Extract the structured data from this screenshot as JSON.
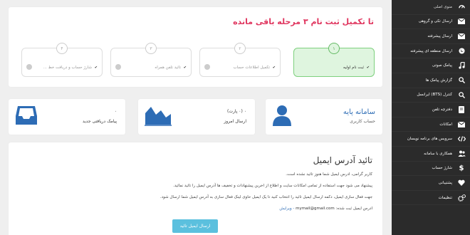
{
  "sidebar": {
    "items": [
      {
        "label": "منوی اصلی",
        "icon": "dashboard-icon"
      },
      {
        "label": "ارسال تکی و گروهی",
        "icon": "envelope-icon"
      },
      {
        "label": "ارسال پیشرفته",
        "icon": "envelope-icon"
      },
      {
        "label": "ارسال منطقه ای پیشرفته",
        "icon": "globe-icon"
      },
      {
        "label": "پیامک صوتی",
        "icon": "music-icon"
      },
      {
        "label": "گزارش پیامک ها",
        "icon": "search-icon"
      },
      {
        "label": "کنترل (BTS) ایرانسل",
        "icon": "search-icon"
      },
      {
        "label": "دفترچه تلفن",
        "icon": "phonebook-icon"
      },
      {
        "label": "امکانات",
        "icon": "envelope-icon"
      },
      {
        "label": "سرویس های برنامه نویسان",
        "icon": "code-icon"
      },
      {
        "label": "همکاری با سامانه",
        "icon": "users-icon"
      },
      {
        "label": "شارژ حساب",
        "icon": "dollar-icon"
      },
      {
        "label": "پشتیبانی",
        "icon": "heart-icon"
      },
      {
        "label": "تنظیمات",
        "icon": "cogs-icon"
      }
    ]
  },
  "steps": {
    "title": "تا تکمیل ثبت نام ۳ مرحله باقی مانده",
    "items": [
      {
        "num": "۱",
        "label": "ثبت نام اولیه"
      },
      {
        "num": "۲",
        "label": "تکمیل اطلاعات حساب"
      },
      {
        "num": "۳",
        "label": "تائید تلفن همراه"
      },
      {
        "num": "۴",
        "label": "شارژ حساب و دریافت خط ..."
      }
    ]
  },
  "stats": {
    "plan": {
      "title": "سامانه پایه",
      "sub": "حساب کاربری"
    },
    "sent": {
      "value": "۰ (۰ پارت)",
      "label": "ارسال امروز"
    },
    "inbox": {
      "value": "۰",
      "label": "پیامک دریافتی جدید"
    }
  },
  "email": {
    "title": "تائید آدرس ایمیل",
    "line1": "کاربر گرامی، ادرس ایمیل شما هنوز تائید نشده است.",
    "line2": "پیشنهاد می شود جهت استفاده از تمامی امکانات سایت و اطلاع از اخرین پیشنهادات و تخفیف ها آدرس ایمیل را تائید نمائید.",
    "line3": "جهت فعال سازی ایمیل، دکمه ارسال ایمیل تائید را انتخاب کنید تا یک ایمیل حاوی لینک فعال سازی به آدرس ایمیل شما ارسال شود.",
    "registered_label": "ادرس ایمیل ثبت شده:",
    "address": "mymail@gmail.com",
    "edit": "- ویرایش",
    "button": "ارسال ایمیل تائید"
  }
}
